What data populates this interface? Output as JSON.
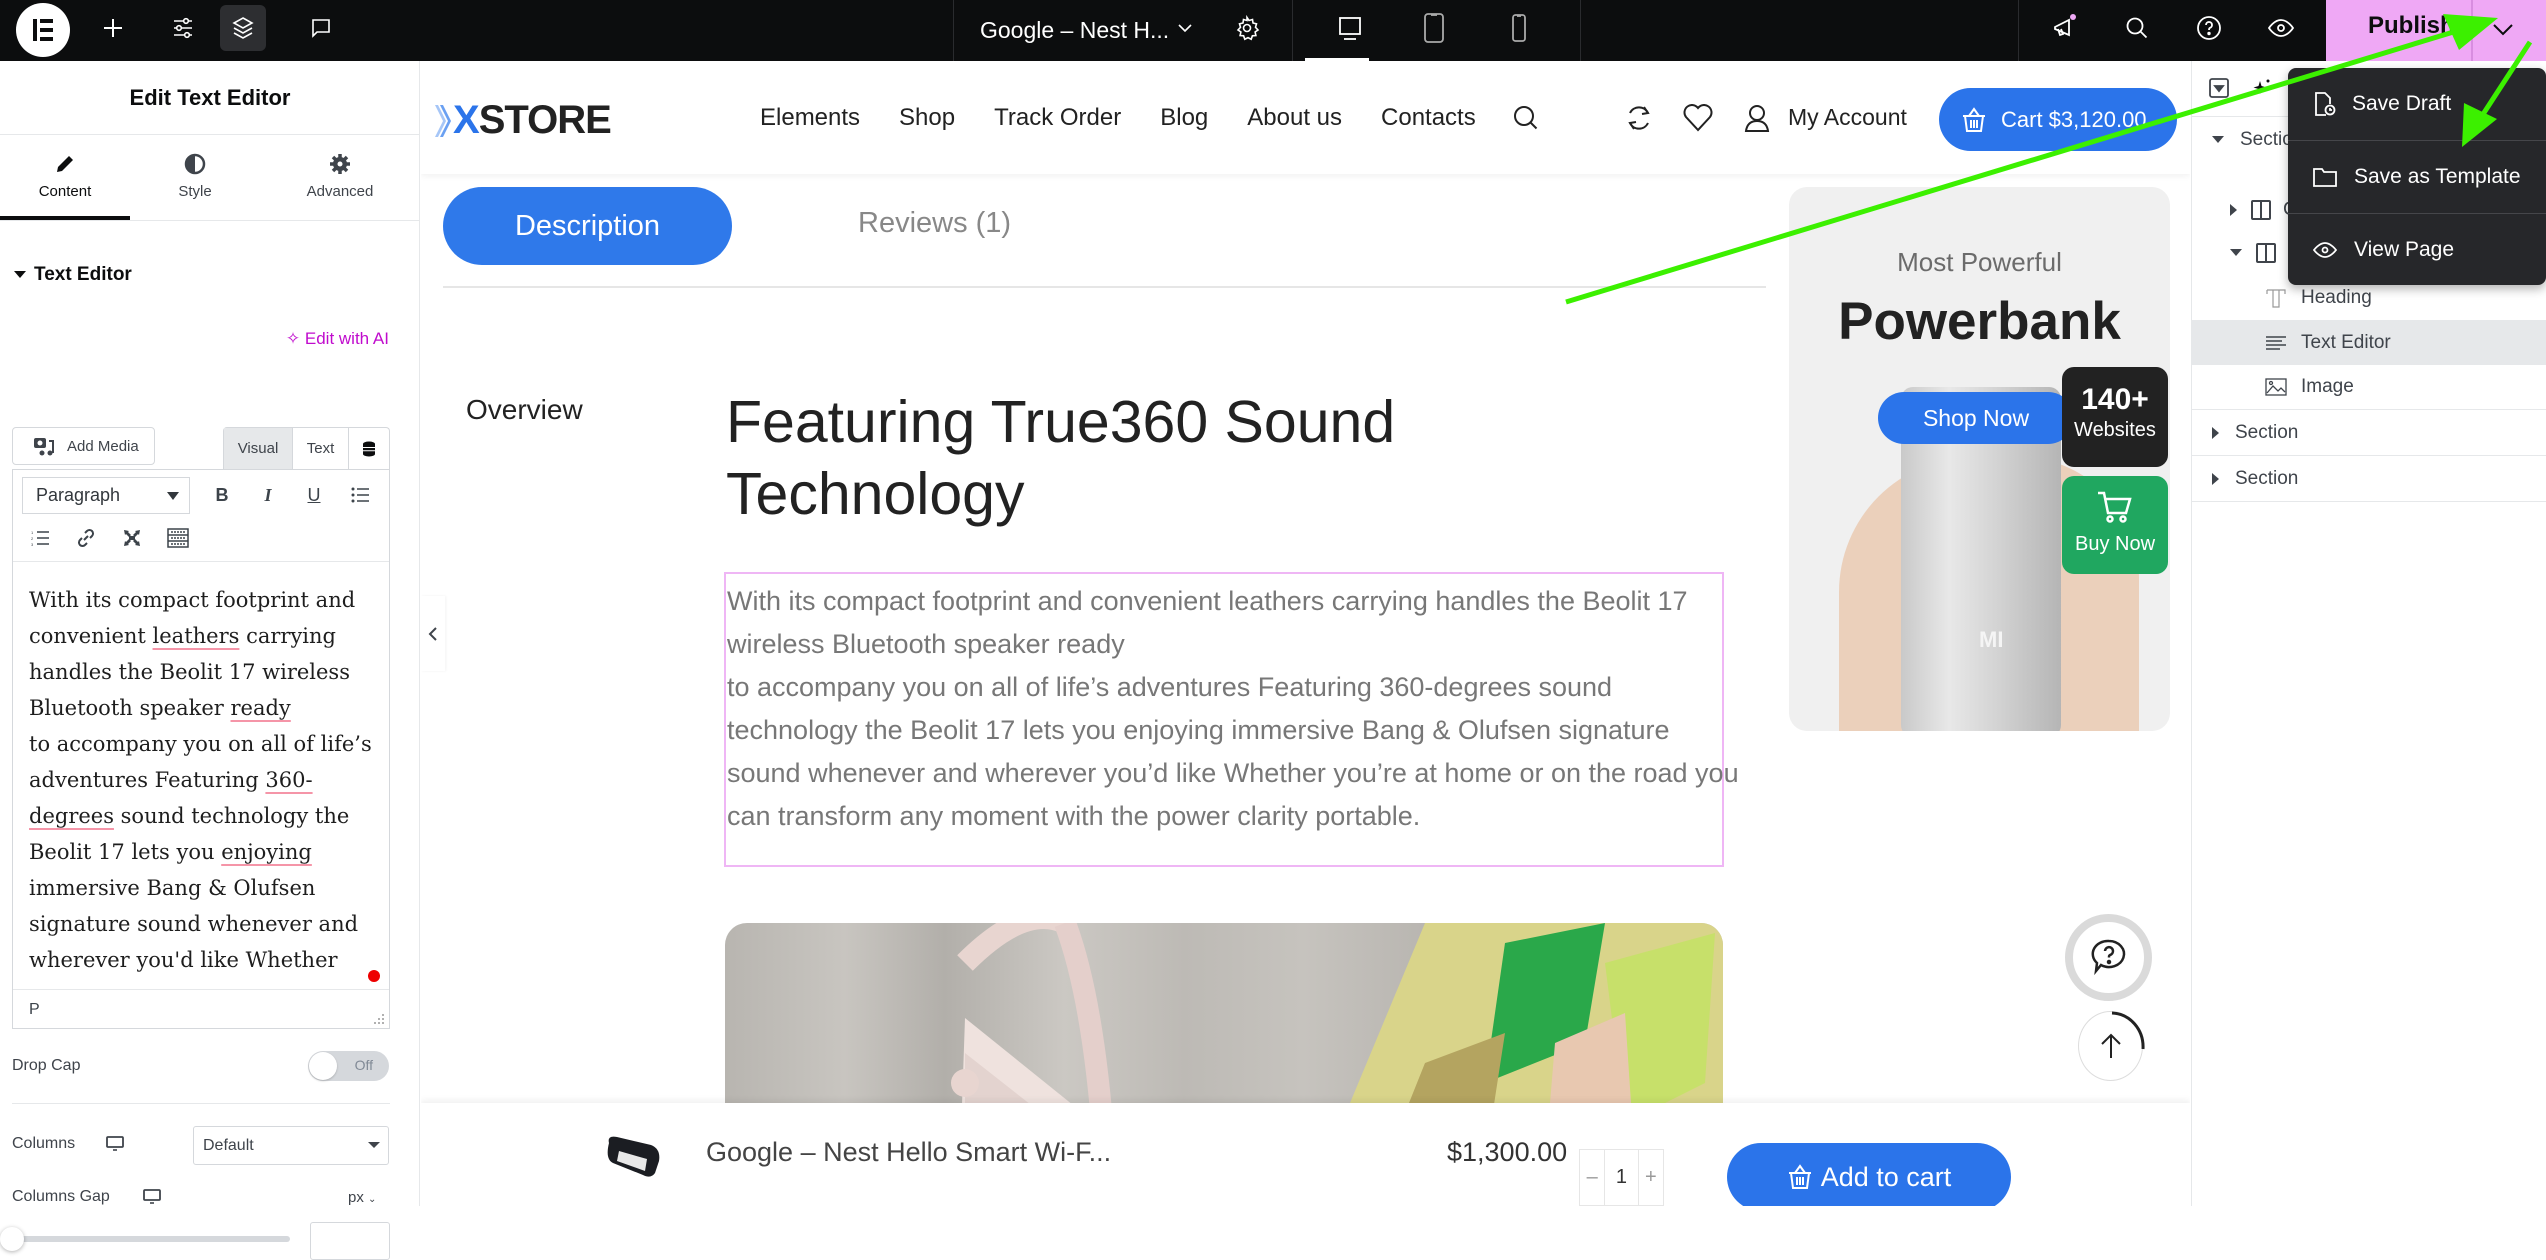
{
  "topbar": {
    "document_title": "Google – Nest H...",
    "publish_label": "Publish",
    "icons": [
      "elementor-logo-icon",
      "plus-icon",
      "sliders-icon",
      "layers-icon",
      "comment-icon",
      "gear-icon",
      "desktop-icon",
      "tablet-icon",
      "mobile-icon",
      "megaphone-icon",
      "search-icon",
      "help-icon",
      "eye-icon",
      "chevron-down-icon"
    ]
  },
  "publish_menu": {
    "items": [
      {
        "label": "Save Draft",
        "icon": "draft-clock-icon"
      },
      {
        "label": "Save as Template",
        "icon": "folder-icon"
      },
      {
        "label": "View Page",
        "icon": "eye-icon"
      }
    ]
  },
  "left_panel": {
    "title": "Edit Text Editor",
    "tabs": [
      {
        "label": "Content",
        "icon": "pencil-icon",
        "active": true
      },
      {
        "label": "Style",
        "icon": "contrast-icon",
        "active": false
      },
      {
        "label": "Advanced",
        "icon": "gear-icon",
        "active": false
      }
    ],
    "section_title": "Text Editor",
    "edit_with_ai": "Edit with AI",
    "add_media": "Add Media",
    "mode_tabs": [
      "Visual",
      "Text"
    ],
    "paragraph_select": "Paragraph",
    "editor_lines": [
      "With its compact footprint and",
      "convenient |leathers| carrying",
      "handles the Beolit 17 wireless",
      "Bluetooth speaker |ready|",
      "to accompany you on all of life’s",
      "adventures Featuring |360-|",
      "|degrees| sound technology the",
      "Beolit 17 lets you |enjoying|",
      "immersive Bang & Olufsen",
      "signature sound whenever and",
      "wherever you'd like Whether"
    ],
    "status_path": "P",
    "drop_cap_label": "Drop Cap",
    "drop_cap_state": "Off",
    "columns_label": "Columns",
    "columns_value": "Default",
    "columns_gap_label": "Columns Gap",
    "columns_gap_unit": "px",
    "columns_gap_value": ""
  },
  "site": {
    "logo": {
      "prefix": "X",
      "rest": "STORE"
    },
    "nav": [
      "Elements",
      "Shop",
      "Track Order",
      "Blog",
      "About us",
      "Contacts"
    ],
    "my_account": "My Account",
    "cart": "Cart $3,120.00",
    "tabs": {
      "description": "Description",
      "reviews": "Reviews (1)"
    },
    "overview": "Overview",
    "heading": "Featuring True360 Sound Technology",
    "body_lines": [
      "With its compact footprint and convenient leathers carrying handles the Beolit 17",
      "wireless Bluetooth speaker ready",
      "to accompany you on all of life’s adventures Featuring 360-degrees sound",
      "technology the Beolit 17 lets you enjoying immersive Bang & Olufsen signature",
      "sound whenever and wherever you’d like Whether you’re at home or on the road you",
      "can transform any moment with the power clarity portable."
    ],
    "promo": {
      "subtitle": "Most Powerful",
      "title": "Powerbank",
      "button": "Shop Now",
      "brand_mark": "MI"
    },
    "badge_websites": {
      "count": "140+",
      "label": "Websites"
    },
    "badge_buy": {
      "label": "Buy Now"
    },
    "sticky": {
      "product": "Google – Nest Hello Smart Wi-F...",
      "price": "$1,300.00",
      "qty": "1",
      "qty_minus": "–",
      "qty_plus": "+",
      "add_to_cart": "Add to cart"
    }
  },
  "navigator": {
    "rows": [
      {
        "label": "Section",
        "level": 0,
        "expanded": true
      },
      {
        "label": "Column",
        "level": 1,
        "expanded": false
      },
      {
        "label": "Column",
        "level": 1,
        "expanded": true
      },
      {
        "label": "Heading",
        "level": 2
      },
      {
        "label": "Text Editor",
        "level": 2,
        "selected": true
      },
      {
        "label": "Image",
        "level": 2
      },
      {
        "label": "Section",
        "level": 0,
        "expanded": false
      },
      {
        "label": "Section",
        "level": 0,
        "expanded": false
      }
    ]
  },
  "colors": {
    "accent_blue": "#2b74ea",
    "publish_pink": "#efa8f5",
    "ai_magenta": "#c00bcd",
    "buy_green": "#20a760",
    "annotation_green": "#3cf000"
  }
}
